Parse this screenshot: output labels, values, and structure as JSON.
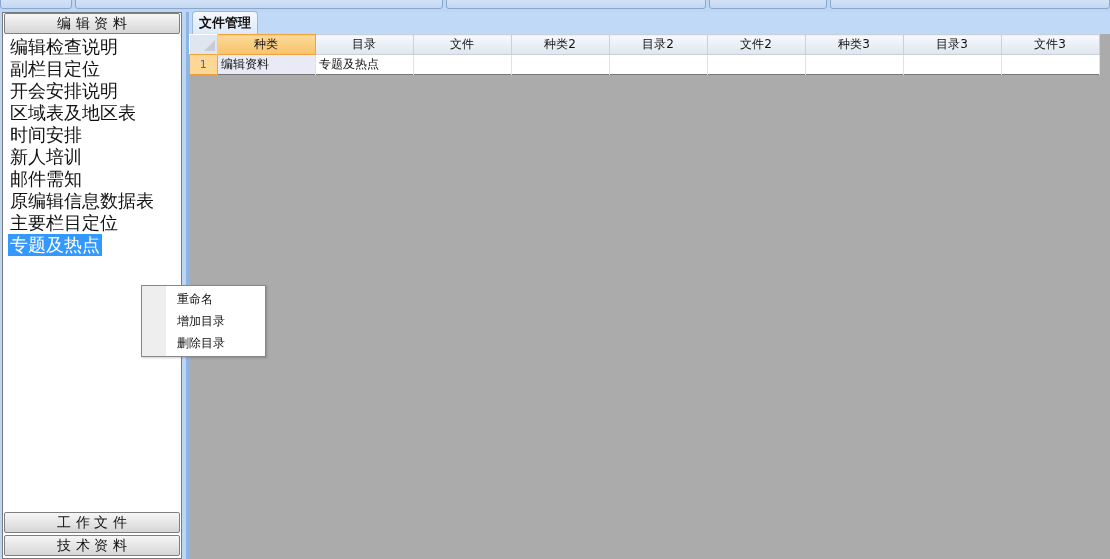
{
  "top_buttons": [
    {
      "kind": "button"
    },
    {
      "kind": "button"
    },
    {
      "kind": "button"
    },
    {
      "kind": "button"
    },
    {
      "kind": "button"
    }
  ],
  "sidebar": {
    "header": "编 辑 资 料",
    "items": [
      {
        "label": "编辑检查说明",
        "selected": false
      },
      {
        "label": "副栏目定位",
        "selected": false
      },
      {
        "label": "开会安排说明",
        "selected": false
      },
      {
        "label": "区域表及地区表",
        "selected": false
      },
      {
        "label": "时间安排",
        "selected": false
      },
      {
        "label": "新人培训",
        "selected": false
      },
      {
        "label": "邮件需知",
        "selected": false
      },
      {
        "label": "原编辑信息数据表",
        "selected": false
      },
      {
        "label": "主要栏目定位",
        "selected": false
      },
      {
        "label": "专题及热点",
        "selected": true
      }
    ],
    "footer_buttons": [
      "工 作 文 件",
      "技 术 资 料"
    ]
  },
  "tabs": [
    {
      "label": "文件管理",
      "selected": true
    }
  ],
  "table": {
    "columns": [
      {
        "label": "种类",
        "selected": true
      },
      {
        "label": "目录",
        "selected": false
      },
      {
        "label": "文件",
        "selected": false
      },
      {
        "label": "种类2",
        "selected": false
      },
      {
        "label": "目录2",
        "selected": false
      },
      {
        "label": "文件2",
        "selected": false
      },
      {
        "label": "种类3",
        "selected": false
      },
      {
        "label": "目录3",
        "selected": false
      },
      {
        "label": "文件3",
        "selected": false
      }
    ],
    "rows": [
      {
        "number": "1",
        "selected": true,
        "cells": [
          "编辑资料",
          "专题及热点",
          "",
          "",
          "",
          "",
          "",
          "",
          ""
        ]
      }
    ]
  },
  "context_menu": {
    "items": [
      "重命名",
      "增加目录",
      "删除目录"
    ]
  }
}
